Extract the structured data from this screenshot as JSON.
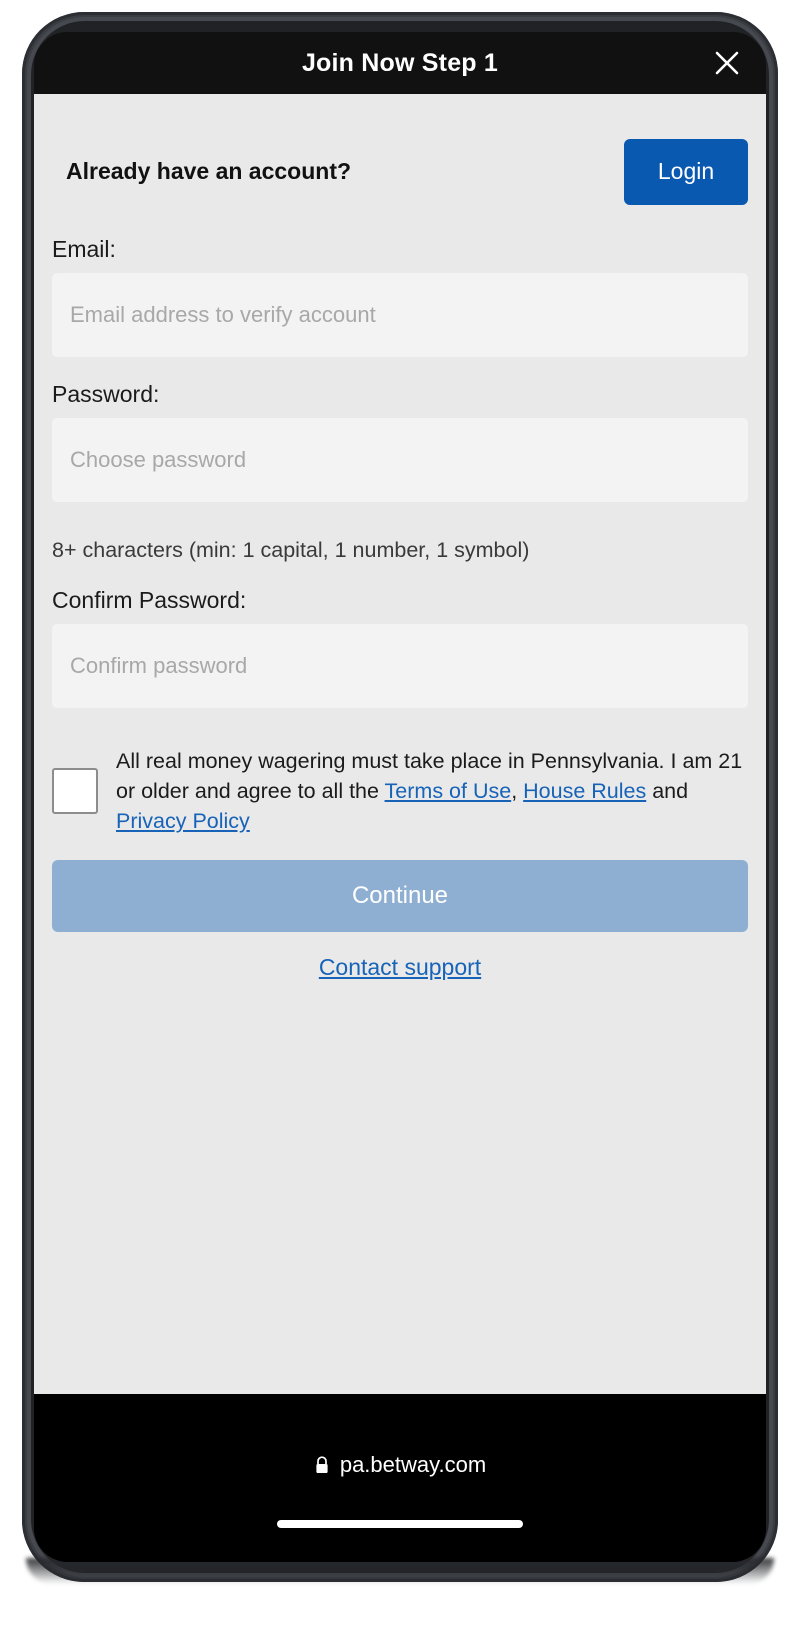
{
  "modal": {
    "title": "Join Now Step 1",
    "close_icon": "close-icon"
  },
  "account_prompt": {
    "text": "Already have an account?",
    "login_label": "Login"
  },
  "form": {
    "email": {
      "label": "Email:",
      "placeholder": "Email address to verify account",
      "value": ""
    },
    "password": {
      "label": "Password:",
      "placeholder": "Choose password",
      "value": "",
      "hint": "8+ characters (min: 1 capital, 1 number, 1 symbol)"
    },
    "confirm_password": {
      "label": "Confirm Password:",
      "placeholder": "Confirm password",
      "value": ""
    }
  },
  "consent": {
    "checked": false,
    "text_part_1": "All real money wagering must take place in Pennsylvania. I am 21 or older and agree to all the ",
    "link_terms": "Terms of Use",
    "separator_1": ", ",
    "link_house_rules": "House Rules",
    "separator_2": " and ",
    "link_privacy": "Privacy Policy"
  },
  "actions": {
    "continue_label": "Continue",
    "continue_disabled": true,
    "support_label": "Contact support"
  },
  "browser": {
    "url": "pa.betway.com",
    "lock_icon": "lock-icon"
  },
  "colors": {
    "brand_blue": "#0a59b0",
    "link_blue": "#1763b8",
    "disabled_blue": "#8fafd2",
    "page_bg": "#e9e9e9",
    "input_bg": "#f3f3f3",
    "chrome_black": "#000000"
  }
}
